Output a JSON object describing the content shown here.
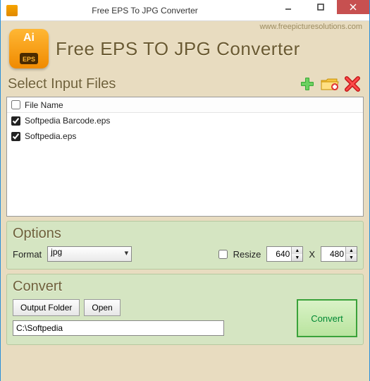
{
  "window": {
    "title": "Free EPS To JPG Converter"
  },
  "header": {
    "website": "www.freepicturesolutions.com",
    "app_title_prefix": "Free ",
    "app_title_accent": "EPS TO JPG",
    "app_title_suffix": " Converter",
    "logo_tag": "EPS"
  },
  "input_files": {
    "section_title": "Select Input Files",
    "header_checked": false,
    "column_label": "File Name",
    "rows": [
      {
        "checked": true,
        "name": "Softpedia Barcode.eps"
      },
      {
        "checked": true,
        "name": "Softpedia.eps"
      }
    ]
  },
  "options": {
    "title": "Options",
    "format_label": "Format",
    "format_value": "jpg",
    "resize_label": "Resize",
    "resize_checked": false,
    "width": "640",
    "x_label": "X",
    "height": "480"
  },
  "convert": {
    "title": "Convert",
    "output_folder_btn": "Output Folder",
    "open_btn": "Open",
    "convert_btn": "Convert",
    "path": "C:\\Softpedia"
  }
}
